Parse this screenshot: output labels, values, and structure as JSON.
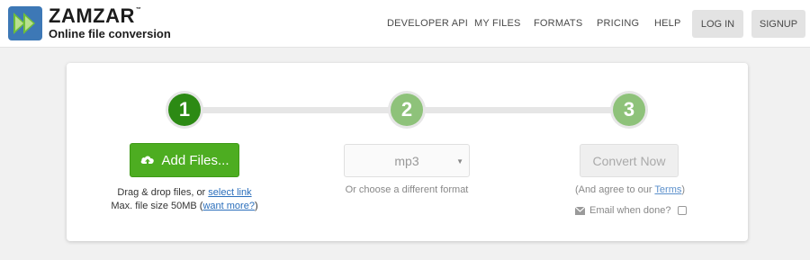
{
  "brand": {
    "name": "ZAMZAR",
    "trademark": "™",
    "tagline": "Online file conversion"
  },
  "nav": {
    "developer_api": "DEVELOPER API",
    "my_files": "MY FILES",
    "formats": "FORMATS",
    "pricing": "PRICING",
    "help": "HELP",
    "log_in": "LOG IN",
    "signup": "SIGNUP"
  },
  "steps": {
    "one": "1",
    "two": "2",
    "three": "3"
  },
  "step1": {
    "button_label": "Add Files...",
    "button_icon": "cloud-upload-icon",
    "drag_text": "Drag & drop files, or",
    "select_link": "select link",
    "max_size": "Max. file size 50MB",
    "want_more_open": "(",
    "want_more_link": "want more?",
    "want_more_close": ")"
  },
  "step2": {
    "selected_format": "mp3",
    "hint": "Or choose a different format"
  },
  "step3": {
    "button_label": "Convert Now",
    "agree_prefix": "(And agree to our",
    "terms_link": "Terms",
    "agree_suffix": ")",
    "email_label": "Email when done?",
    "email_icon": "envelope-icon",
    "email_checked": false
  },
  "colors": {
    "brand_blue": "#3d78b6",
    "green_active": "#2c8a14",
    "green_inactive": "#8ec27a",
    "add_button": "#4dad21",
    "link": "#2a6ebb"
  }
}
